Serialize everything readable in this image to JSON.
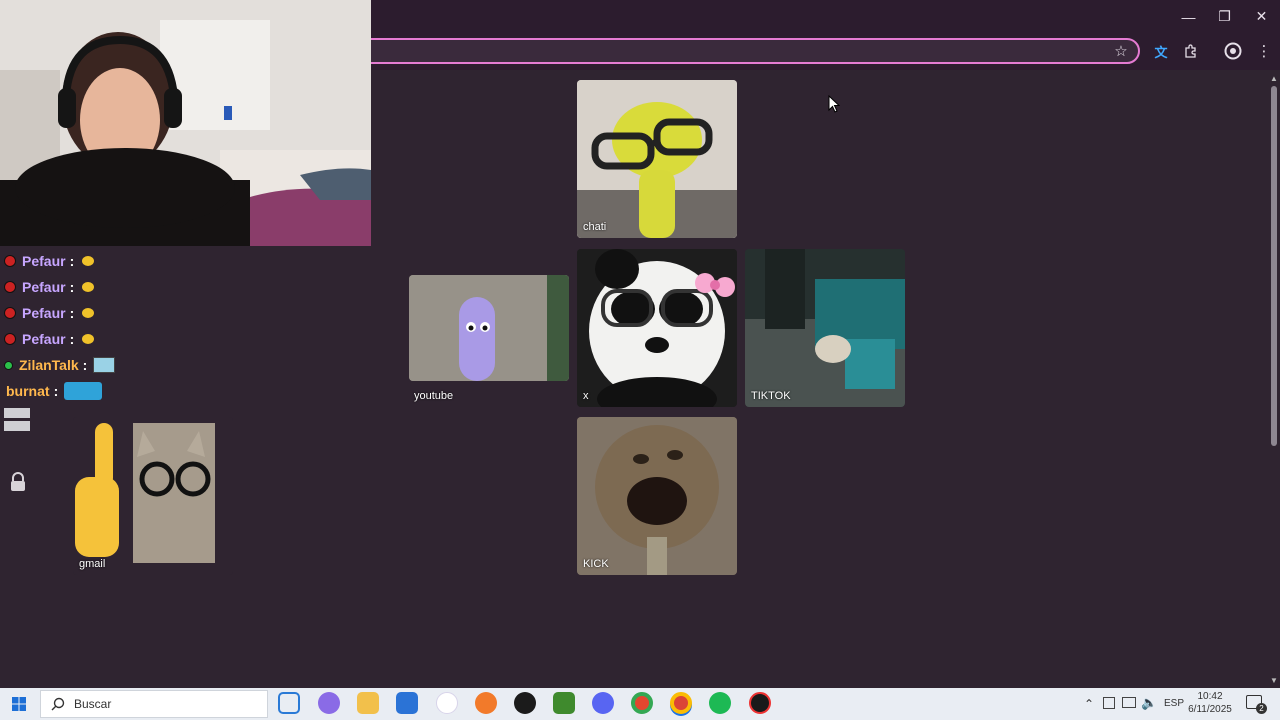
{
  "browser": {
    "window_controls": {
      "minimize": "—",
      "restore": "❐",
      "close": "✕"
    },
    "toolbar_icons": [
      "star-icon",
      "translate-icon",
      "extensions-icon",
      "profile-icon",
      "menu-icon"
    ]
  },
  "tiles": [
    {
      "id": "chati",
      "label": "chati"
    },
    {
      "id": "youtube",
      "label": "youtube"
    },
    {
      "id": "x",
      "label": "x"
    },
    {
      "id": "tiktok",
      "label": "TIKTOK"
    },
    {
      "id": "kick",
      "label": "KICK"
    },
    {
      "id": "gmail",
      "label": "gmail"
    }
  ],
  "chat": {
    "messages": [
      {
        "user": "Pefaur",
        "sep": ":",
        "color": "#c7a6ff"
      },
      {
        "user": "Pefaur",
        "sep": ":",
        "color": "#c7a6ff"
      },
      {
        "user": "Pefaur",
        "sep": ":",
        "color": "#c7a6ff"
      },
      {
        "user": "Pefaur",
        "sep": ":",
        "color": "#c7a6ff"
      },
      {
        "user": "ZilanTalk",
        "sep": ":",
        "color": "#ffb84d"
      },
      {
        "user": "burnat",
        "sep": ":",
        "color": "#ffb84d"
      }
    ]
  },
  "taskbar": {
    "search_placeholder": "Buscar",
    "language": "ESP",
    "time": "10:42",
    "date": "6/11/2025",
    "notification_count": "2"
  },
  "colors": {
    "accent": "#e57bd3",
    "page_bg": "#2f2430",
    "taskbar_bg": "#e9edf3"
  }
}
